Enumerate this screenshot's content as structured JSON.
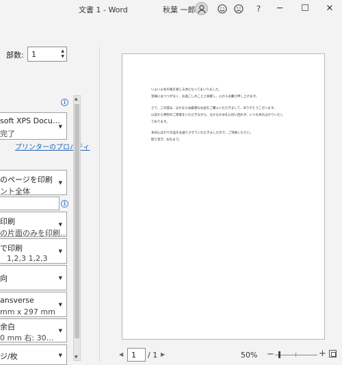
{
  "window": {
    "title": "文書 1  -  Word",
    "user": "秋葉 一郎",
    "help": "?",
    "minimize": "─",
    "maximize": "☐",
    "close": "✕"
  },
  "settings": {
    "copies_label": "部数:",
    "copies_value": "1",
    "printer": {
      "line1": "soft XPS Docu…",
      "line2": "完了",
      "properties_link": "プリンターのプロパティ"
    },
    "pages_dropdown": {
      "line1": "のページを印刷",
      "line2": "ント全体"
    },
    "pages_input": "",
    "sides_dropdown": {
      "line1": "印刷",
      "line2": "の片面のみを印刷…"
    },
    "collate_dropdown": {
      "line1": "で印刷",
      "line2": "1,2,3    1,2,3"
    },
    "orientation_dropdown": {
      "line1": "向",
      "line2": ""
    },
    "paper_dropdown": {
      "line1": "ansverse",
      "line2": "mm x 297 mm"
    },
    "margins_dropdown": {
      "line1": "余白",
      "line2": "0 mm    右: 30…"
    },
    "pages_per_sheet_dropdown": {
      "line1": "ジ/枚",
      "line2": ""
    }
  },
  "preview": {
    "lines": [
      "いよいよ冬の風を感じる頃となってまいりました。",
      "皆様にはつつがなく、お過ごしのことと拝察し、心からお慶び申し上げます。",
      "",
      "さて、この度は、ほかならぬ厳選なお品をご購入いただきまして、ありがとうございます。",
      "以前から特別のご厚意をいただきながら、なかなかお礼に伺い回れず、いつも失礼ばかりいたし",
      "ております。",
      "",
      "本日心ばかりの品をお送りさせていただきましたので、ご笑納ください。",
      "取り急ぎ、お礼まで。"
    ]
  },
  "nav": {
    "current_page": "1",
    "total": "/ 1",
    "zoom": "50%",
    "zoom_level": 0.5
  }
}
